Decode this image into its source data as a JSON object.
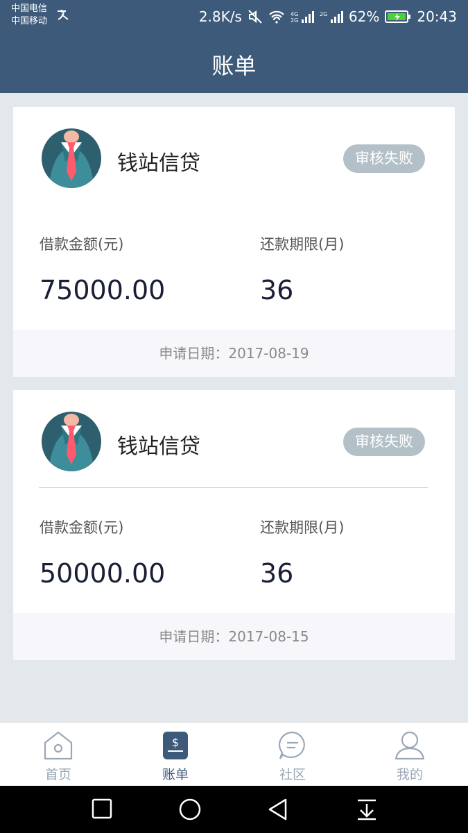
{
  "status_bar": {
    "carrier1": "中国电信",
    "carrier2": "中国移动",
    "speed": "2.8K/s",
    "battery": "62%",
    "time": "20:43"
  },
  "header": {
    "title": "账单"
  },
  "bills": [
    {
      "lender": "钱站信贷",
      "status": "审核失败",
      "amount_label": "借款金额(元)",
      "amount": "75000.00",
      "term_label": "还款期限(月)",
      "term": "36",
      "date_text": "申请日期：2017-08-19"
    },
    {
      "lender": "钱站信贷",
      "status": "审核失败",
      "amount_label": "借款金额(元)",
      "amount": "50000.00",
      "term_label": "还款期限(月)",
      "term": "36",
      "date_text": "申请日期：2017-08-15"
    }
  ],
  "tabs": [
    {
      "label": "首页",
      "icon": "home-icon",
      "active": false
    },
    {
      "label": "账单",
      "icon": "bill-icon",
      "active": true
    },
    {
      "label": "社区",
      "icon": "chat-icon",
      "active": false
    },
    {
      "label": "我的",
      "icon": "profile-icon",
      "active": false
    }
  ],
  "colors": {
    "header_bg": "#3d5a7a",
    "badge_bg": "#b3c0c7",
    "tab_active": "#3d5a7a",
    "tab_inactive": "#9aa7b4"
  }
}
